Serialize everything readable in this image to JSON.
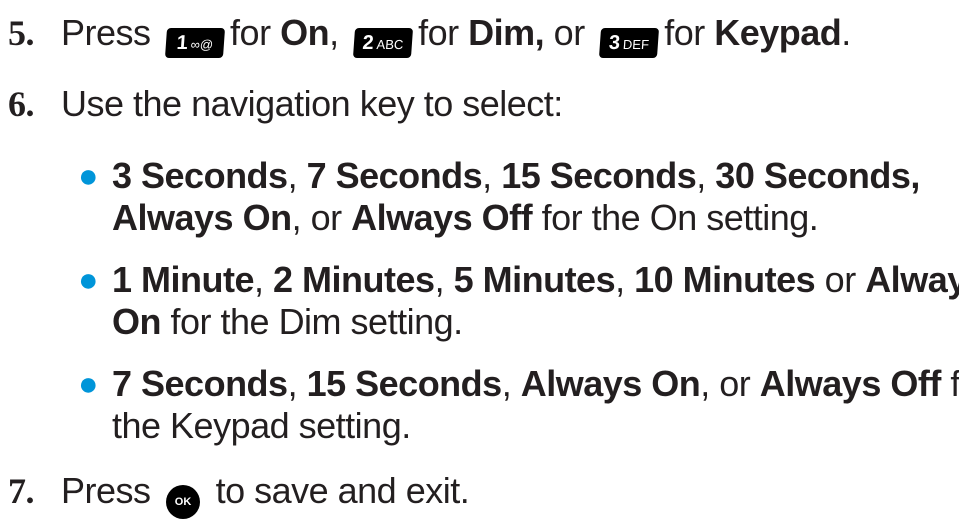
{
  "step5": {
    "number": "5.",
    "press": "Press",
    "key1": {
      "digit": "1",
      "letters": "∞@",
      "icon": "key-1-icon"
    },
    "for1": "for",
    "on": "On",
    "comma1": ",",
    "key2": {
      "digit": "2",
      "letters": "ABC",
      "icon": "key-2-icon"
    },
    "for2": "for",
    "dim": "Dim,",
    "or": "or",
    "key3": {
      "digit": "3",
      "letters": "DEF",
      "icon": "key-3-icon"
    },
    "for3": "for",
    "keypad": "Keypad",
    "period": "."
  },
  "step6": {
    "number": "6.",
    "text": "Use the navigation key to select:",
    "bullet_color": "#0095d9",
    "on_bullet": {
      "line1": [
        {
          "t": "3 Seconds",
          "b": true
        },
        {
          "t": ", ",
          "b": false
        },
        {
          "t": "7 Seconds",
          "b": true
        },
        {
          "t": ", ",
          "b": false
        },
        {
          "t": "15 Seconds",
          "b": true
        },
        {
          "t": ", ",
          "b": false
        },
        {
          "t": "30 Seconds,",
          "b": true
        }
      ],
      "line2": [
        {
          "t": "Always On",
          "b": true
        },
        {
          "t": ", or ",
          "b": false
        },
        {
          "t": "Always Off",
          "b": true
        },
        {
          "t": " for the On setting.",
          "b": false
        }
      ]
    },
    "dim_bullet": {
      "line1": [
        {
          "t": "1 Minute",
          "b": true
        },
        {
          "t": ", ",
          "b": false
        },
        {
          "t": "2 Minutes",
          "b": true
        },
        {
          "t": ", ",
          "b": false
        },
        {
          "t": "5 Minutes",
          "b": true
        },
        {
          "t": ", ",
          "b": false
        },
        {
          "t": "10 Minutes",
          "b": true
        },
        {
          "t": " or ",
          "b": false
        },
        {
          "t": "Always",
          "b": true
        }
      ],
      "line2": [
        {
          "t": "On",
          "b": true
        },
        {
          "t": " for the Dim setting.",
          "b": false
        }
      ]
    },
    "keypad_bullet": {
      "line1": [
        {
          "t": "7 Seconds",
          "b": true
        },
        {
          "t": ", ",
          "b": false
        },
        {
          "t": "15 Seconds",
          "b": true
        },
        {
          "t": ", ",
          "b": false
        },
        {
          "t": "Always On",
          "b": true
        },
        {
          "t": ", or ",
          "b": false
        },
        {
          "t": "Always Off",
          "b": true
        },
        {
          "t": " for",
          "b": false
        }
      ],
      "line2": [
        {
          "t": "the Keypad setting.",
          "b": false
        }
      ]
    }
  },
  "step7": {
    "number": "7.",
    "press": "Press",
    "ok_key": {
      "label": "OK",
      "icon": "ok-key-icon"
    },
    "rest": "to save and exit."
  }
}
